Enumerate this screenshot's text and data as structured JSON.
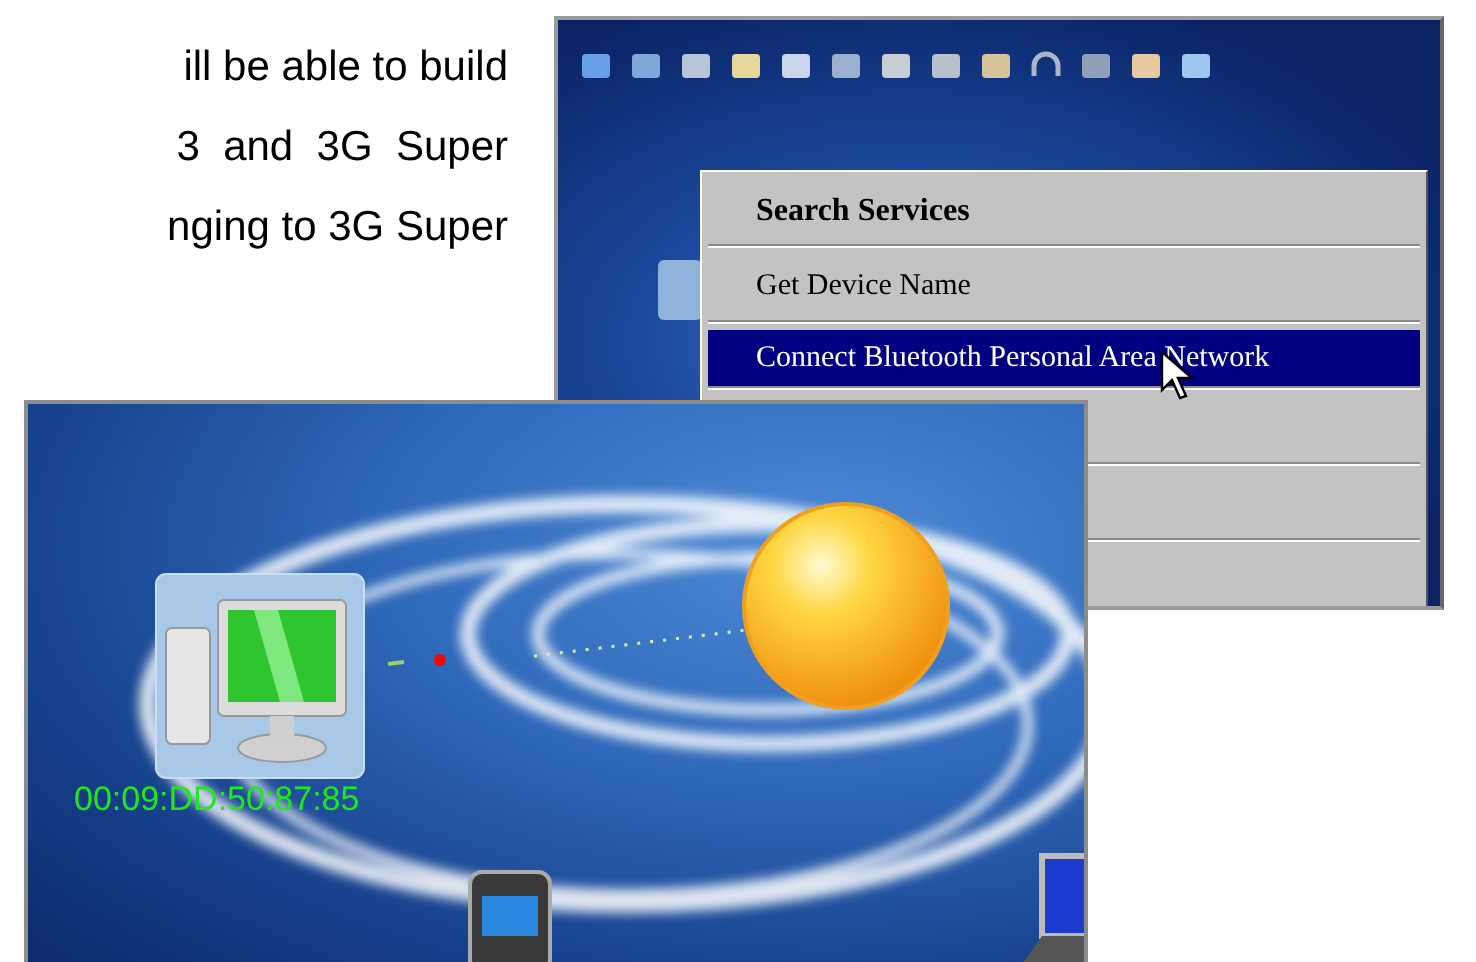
{
  "document_text": {
    "lines": [
      {
        "text": "ill be able to build"
      },
      {
        "text": "3  and  3G  Super"
      },
      {
        "text": "nging to 3G Super"
      }
    ]
  },
  "back_screenshot": {
    "context_menu": {
      "items": [
        {
          "label": "Search Services",
          "kind": "header",
          "selected": false
        },
        {
          "label": "Get Device Name",
          "kind": "item",
          "selected": false
        },
        {
          "label": "Connect Bluetooth Personal Area Network",
          "kind": "item",
          "selected": true
        }
      ]
    }
  },
  "front_screenshot": {
    "device_label": "00:09:DD:50:87:85"
  }
}
